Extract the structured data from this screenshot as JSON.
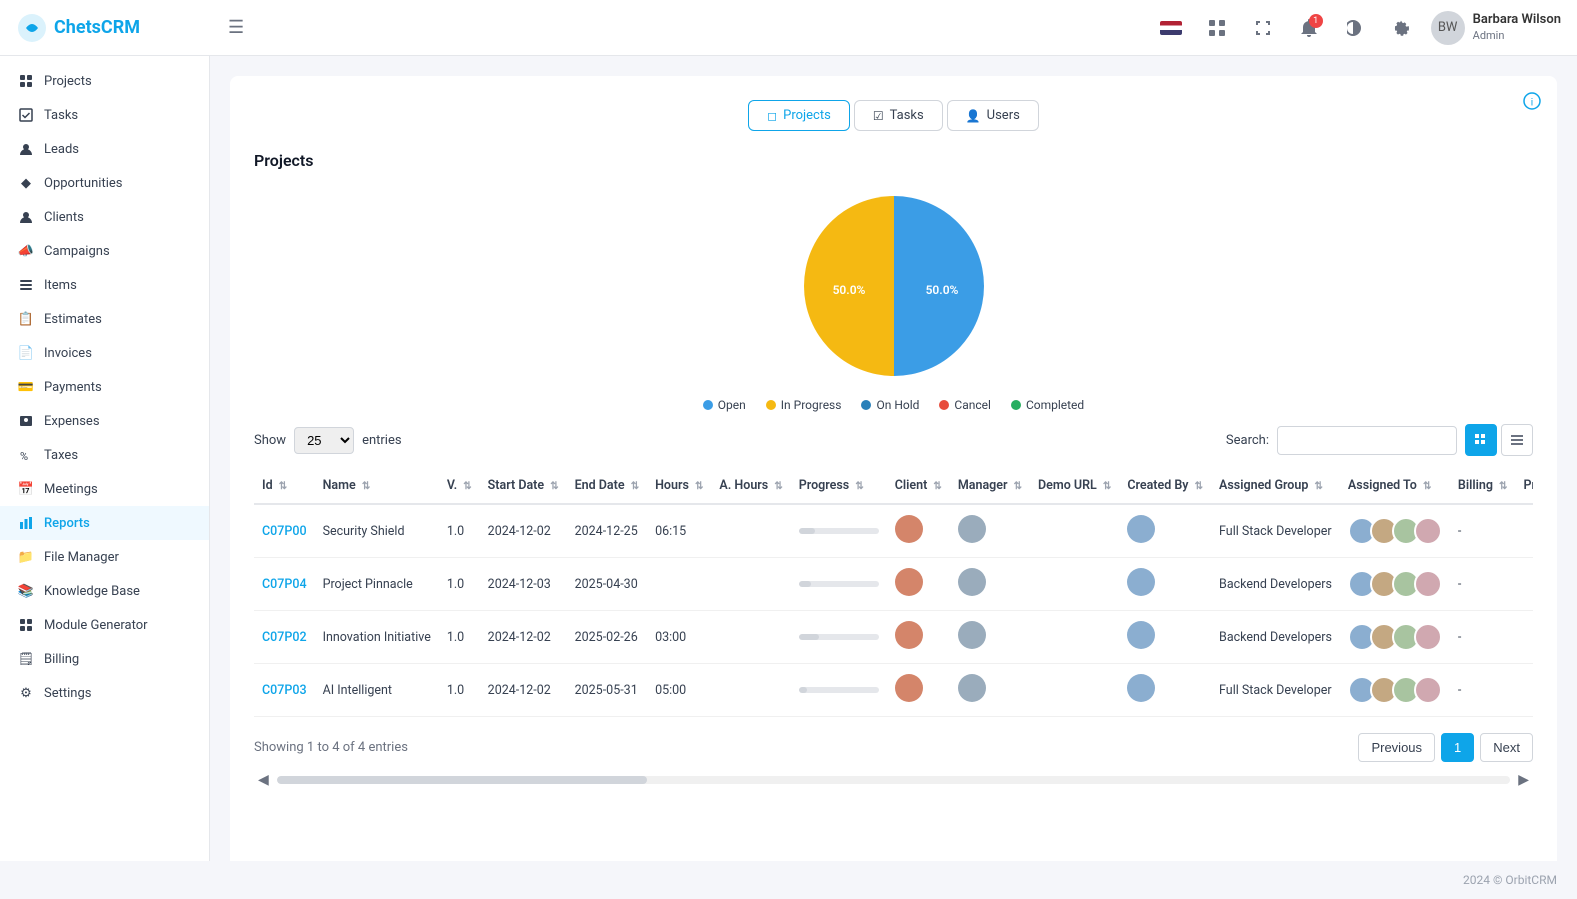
{
  "app": {
    "name": "ChetsCRM",
    "footer": "2024 © OrbitCRM"
  },
  "topbar": {
    "hamburger_label": "☰",
    "user": {
      "name": "Barbara Wilson",
      "role": "Admin"
    },
    "notification_count": "1"
  },
  "sidebar": {
    "items": [
      {
        "id": "projects",
        "label": "Projects",
        "icon": "◻"
      },
      {
        "id": "tasks",
        "label": "Tasks",
        "icon": "☑"
      },
      {
        "id": "leads",
        "label": "Leads",
        "icon": "⟳"
      },
      {
        "id": "opportunities",
        "label": "Opportunities",
        "icon": "◆"
      },
      {
        "id": "clients",
        "label": "Clients",
        "icon": "👤"
      },
      {
        "id": "campaigns",
        "label": "Campaigns",
        "icon": "📣"
      },
      {
        "id": "items",
        "label": "Items",
        "icon": "≡"
      },
      {
        "id": "estimates",
        "label": "Estimates",
        "icon": "📋"
      },
      {
        "id": "invoices",
        "label": "Invoices",
        "icon": "📄"
      },
      {
        "id": "payments",
        "label": "Payments",
        "icon": "💳"
      },
      {
        "id": "expenses",
        "label": "Expenses",
        "icon": "💰"
      },
      {
        "id": "taxes",
        "label": "Taxes",
        "icon": "%"
      },
      {
        "id": "meetings",
        "label": "Meetings",
        "icon": "📅"
      },
      {
        "id": "reports",
        "label": "Reports",
        "icon": "📊",
        "active": true
      },
      {
        "id": "file-manager",
        "label": "File Manager",
        "icon": "📁"
      },
      {
        "id": "knowledge-base",
        "label": "Knowledge Base",
        "icon": "📚"
      },
      {
        "id": "module-generator",
        "label": "Module Generator",
        "icon": "⊞"
      },
      {
        "id": "billing",
        "label": "Billing",
        "icon": "🗒"
      },
      {
        "id": "settings",
        "label": "Settings",
        "icon": "⚙"
      }
    ]
  },
  "tabs": [
    {
      "id": "projects",
      "label": "Projects",
      "icon": "◻",
      "active": true
    },
    {
      "id": "tasks",
      "label": "Tasks",
      "icon": "☑"
    },
    {
      "id": "users",
      "label": "Users",
      "icon": "👤"
    }
  ],
  "page": {
    "title": "Projects",
    "chart": {
      "segments": [
        {
          "label": "Open",
          "color": "#3b9de6",
          "percent": 0,
          "legendColor": "#3b9de6"
        },
        {
          "label": "In Progress",
          "color": "#f5b912",
          "percent": 50,
          "legendColor": "#f5b912"
        },
        {
          "label": "On Hold",
          "color": "#2980b9",
          "percent": 50,
          "legendColor": "#2980b9"
        },
        {
          "label": "Cancel",
          "color": "#e74c3c",
          "percent": 0,
          "legendColor": "#e74c3c"
        },
        {
          "label": "Completed",
          "color": "#27ae60",
          "percent": 0,
          "legendColor": "#27ae60"
        }
      ],
      "labels": {
        "in_progress": "50.0%",
        "on_hold": "50.0%"
      }
    },
    "table": {
      "show_label": "Show",
      "entries_label": "entries",
      "search_label": "Search:",
      "search_placeholder": "",
      "show_value": "25",
      "columns": [
        "Id",
        "Name",
        "V.",
        "Start Date",
        "End Date",
        "Hours",
        "A. Hours",
        "Progress",
        "Client",
        "Manager",
        "Demo URL",
        "Created By",
        "Assigned Group",
        "Assigned To",
        "Billing",
        "Price"
      ],
      "rows": [
        {
          "id": "C07P00",
          "name": "Security Shield",
          "version": "1.0",
          "start_date": "2024-12-02",
          "end_date": "2024-12-25",
          "hours": "06:15",
          "a_hours": "",
          "progress": 20,
          "assigned_group": "Full Stack Developer",
          "billing": "-",
          "price": ""
        },
        {
          "id": "C07P04",
          "name": "Project Pinnacle",
          "version": "1.0",
          "start_date": "2024-12-03",
          "end_date": "2025-04-30",
          "hours": "",
          "a_hours": "",
          "progress": 15,
          "assigned_group": "Backend Developers",
          "billing": "-",
          "price": ""
        },
        {
          "id": "C07P02",
          "name": "Innovation Initiative",
          "version": "1.0",
          "start_date": "2024-12-02",
          "end_date": "2025-02-26",
          "hours": "03:00",
          "a_hours": "",
          "progress": 25,
          "assigned_group": "Backend Developers",
          "billing": "-",
          "price": ""
        },
        {
          "id": "C07P03",
          "name": "AI Intelligent",
          "version": "1.0",
          "start_date": "2024-12-02",
          "end_date": "2025-05-31",
          "hours": "05:00",
          "a_hours": "",
          "progress": 10,
          "assigned_group": "Full Stack Developer",
          "billing": "-",
          "price": ""
        }
      ],
      "showing_text": "Showing 1 to 4 of 4 entries",
      "pagination": {
        "previous": "Previous",
        "next": "Next",
        "current_page": "1"
      }
    }
  }
}
